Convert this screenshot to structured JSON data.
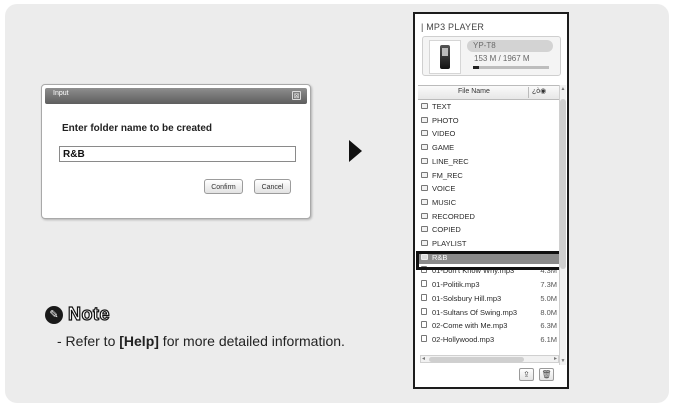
{
  "dialog": {
    "title": "Input",
    "close_glyph": "⊠",
    "prompt": "Enter folder name to be created",
    "input_value": "R&B",
    "confirm_label": "Confirm",
    "cancel_label": "Cancel"
  },
  "note": {
    "icon": "pencil-icon",
    "icon_glyph": "✎",
    "title": "Note",
    "text_prefix": "- Refer to ",
    "text_bold": "[Help]",
    "text_suffix": " for more detailed information."
  },
  "player": {
    "title": "| MP3 PLAYER",
    "model": "YP-T8",
    "capacity": "153 M / 1967 M",
    "capacity_used_fraction": 0.08,
    "column_header": "File Name",
    "sort_glyph": "¿ò◉",
    "items": [
      {
        "type": "folder",
        "name": "TEXT",
        "size": ""
      },
      {
        "type": "folder",
        "name": "PHOTO",
        "size": ""
      },
      {
        "type": "folder",
        "name": "VIDEO",
        "size": ""
      },
      {
        "type": "folder",
        "name": "GAME",
        "size": ""
      },
      {
        "type": "folder",
        "name": "LINE_REC",
        "size": ""
      },
      {
        "type": "folder",
        "name": "FM_REC",
        "size": ""
      },
      {
        "type": "folder",
        "name": "VOICE",
        "size": ""
      },
      {
        "type": "folder",
        "name": "MUSIC",
        "size": ""
      },
      {
        "type": "folder",
        "name": "RECORDED",
        "size": ""
      },
      {
        "type": "folder",
        "name": "COPIED",
        "size": ""
      },
      {
        "type": "folder",
        "name": "PLAYLIST",
        "size": ""
      },
      {
        "type": "folder",
        "name": "R&B",
        "size": "",
        "selected": true
      },
      {
        "type": "file",
        "name": "01-Don't Know Why.mp3",
        "size": "4.3M"
      },
      {
        "type": "file",
        "name": "01-Politik.mp3",
        "size": "7.3M"
      },
      {
        "type": "file",
        "name": "01-Solsbury Hill.mp3",
        "size": "5.0M"
      },
      {
        "type": "file",
        "name": "01-Sultans Of Swing.mp3",
        "size": "8.0M"
      },
      {
        "type": "file",
        "name": "02-Come with Me.mp3",
        "size": "6.3M"
      },
      {
        "type": "file",
        "name": "02-Hollywood.mp3",
        "size": "6.1M"
      }
    ],
    "upload_icon": "upload-icon",
    "delete_icon": "trash-icon"
  }
}
